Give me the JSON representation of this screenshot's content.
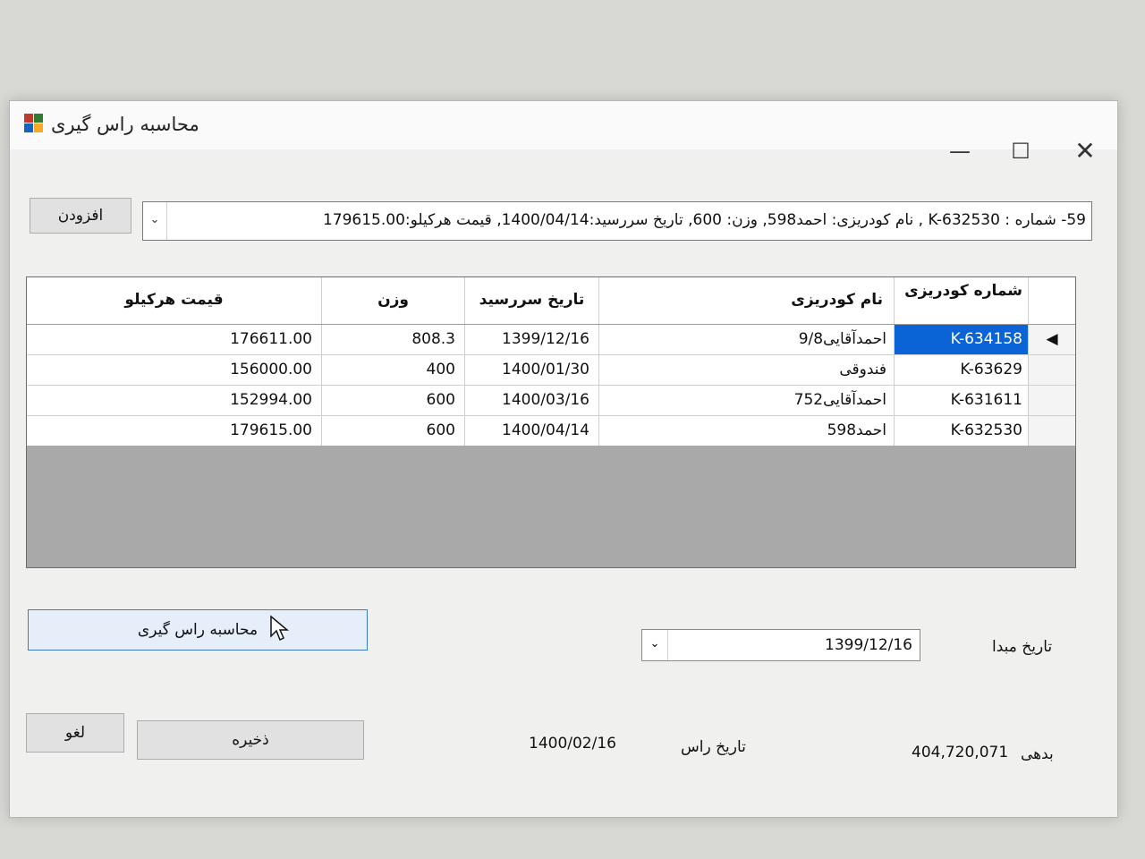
{
  "window": {
    "title": "محاسبه راس گیری",
    "minimize_glyph": "—",
    "maximize_glyph": "☐",
    "close_glyph": "✕"
  },
  "toolbar": {
    "add_label": "افزودن",
    "record_combo_text": "59- شماره : K-632530 , نام کودریزی: احمد598, وزن: 600, تاریخ سررسید:1400/04/14, قیمت هرکیلو:179615.00",
    "combo_arrow": "⌄"
  },
  "grid": {
    "headers": {
      "price": "قیمت هرکیلو",
      "weight": "وزن",
      "due_date": "تاریخ سررسید",
      "name": "نام کودریزی",
      "code": "شماره کودریزی"
    },
    "rows": [
      {
        "price": "176611.00",
        "weight": "808.3",
        "due_date": "1399/12/16",
        "name": "احمدآقایی9/8",
        "code": "K-634158",
        "marker": "◀"
      },
      {
        "price": "156000.00",
        "weight": "400",
        "due_date": "1400/01/30",
        "name": "فندوقی",
        "code": "K-63629",
        "marker": ""
      },
      {
        "price": "152994.00",
        "weight": "600",
        "due_date": "1400/03/16",
        "name": "احمدآقایی752",
        "code": "K-631611",
        "marker": ""
      },
      {
        "price": "179615.00",
        "weight": "600",
        "due_date": "1400/04/14",
        "name": "احمد598",
        "code": "K-632530",
        "marker": ""
      }
    ]
  },
  "calc": {
    "button_label": "محاسبه راس گیری"
  },
  "start_date": {
    "label": "تاریخ مبدا",
    "value": "1399/12/16",
    "arrow": "⌄"
  },
  "footer": {
    "cancel_label": "لغو",
    "save_label": "ذخیره",
    "due_date_value": "1400/02/16",
    "due_date_label": "تاریخ راس",
    "debt_value": "404,720,071",
    "debt_label": "بدهی"
  },
  "colors": {
    "selection": "#0a64d6",
    "accent_border": "#3e7bc4"
  }
}
